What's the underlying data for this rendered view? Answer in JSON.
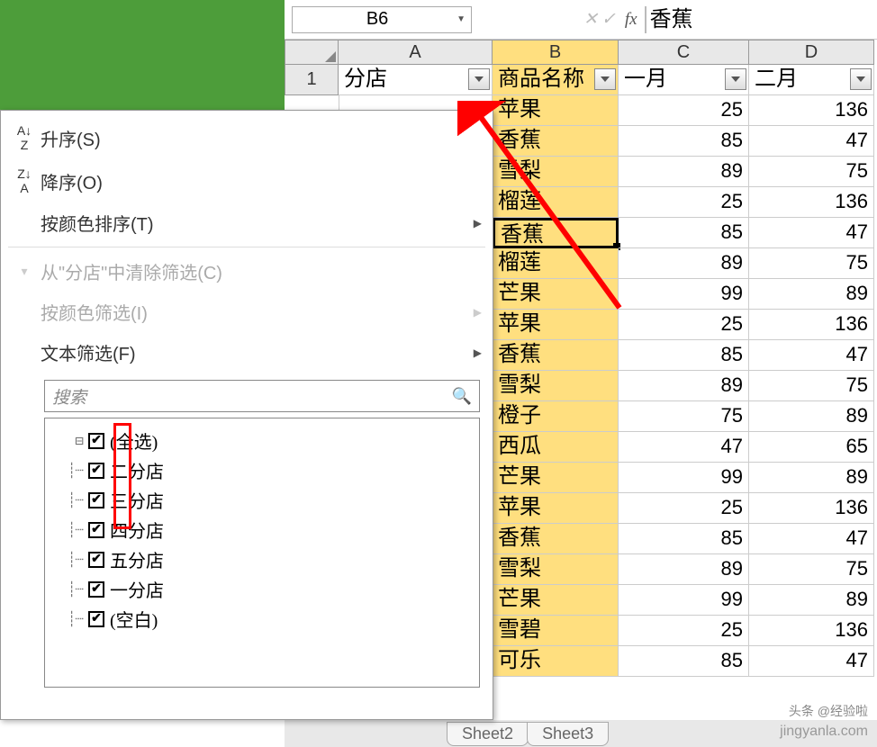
{
  "formula_bar": {
    "cell_ref": "B6",
    "fx_label": "fx",
    "value": "香蕉"
  },
  "columns": [
    "A",
    "B",
    "C",
    "D"
  ],
  "header_row_num": "1",
  "headers": {
    "A": "分店",
    "B": "商品名称",
    "C": "一月",
    "D": "二月"
  },
  "data_rows": [
    {
      "B": "苹果",
      "C": "25",
      "D": "136"
    },
    {
      "B": "香蕉",
      "C": "85",
      "D": "47"
    },
    {
      "B": "雪梨",
      "C": "89",
      "D": "75"
    },
    {
      "B": "榴莲",
      "C": "25",
      "D": "136"
    },
    {
      "B": "香蕉",
      "C": "85",
      "D": "47",
      "active": true
    },
    {
      "B": "榴莲",
      "C": "89",
      "D": "75"
    },
    {
      "B": "芒果",
      "C": "99",
      "D": "89"
    },
    {
      "B": "苹果",
      "C": "25",
      "D": "136"
    },
    {
      "B": "香蕉",
      "C": "85",
      "D": "47"
    },
    {
      "B": "雪梨",
      "C": "89",
      "D": "75"
    },
    {
      "B": "橙子",
      "C": "75",
      "D": "89"
    },
    {
      "B": "西瓜",
      "C": "47",
      "D": "65"
    },
    {
      "B": "芒果",
      "C": "99",
      "D": "89"
    },
    {
      "B": "苹果",
      "C": "25",
      "D": "136"
    },
    {
      "B": "香蕉",
      "C": "85",
      "D": "47"
    },
    {
      "B": "雪梨",
      "C": "89",
      "D": "75"
    },
    {
      "B": "芒果",
      "C": "99",
      "D": "89"
    },
    {
      "B": "雪碧",
      "C": "25",
      "D": "136"
    },
    {
      "B": "可乐",
      "C": "85",
      "D": "47"
    }
  ],
  "filter_menu": {
    "sort_asc": "升序(S)",
    "sort_desc": "降序(O)",
    "sort_color": "按颜色排序(T)",
    "clear_filter": "从\"分店\"中清除筛选(C)",
    "filter_color": "按颜色筛选(I)",
    "text_filter": "文本筛选(F)",
    "search_placeholder": "搜索",
    "items": [
      "(全选)",
      "二分店",
      "三分店",
      "四分店",
      "五分店",
      "一分店",
      "(空白)"
    ]
  },
  "visible_row_number": "1",
  "sheet_tabs": [
    "Sheet2",
    "Sheet3"
  ],
  "watermark": "jingyanla.com",
  "watermark2": "头条 @经验啦"
}
